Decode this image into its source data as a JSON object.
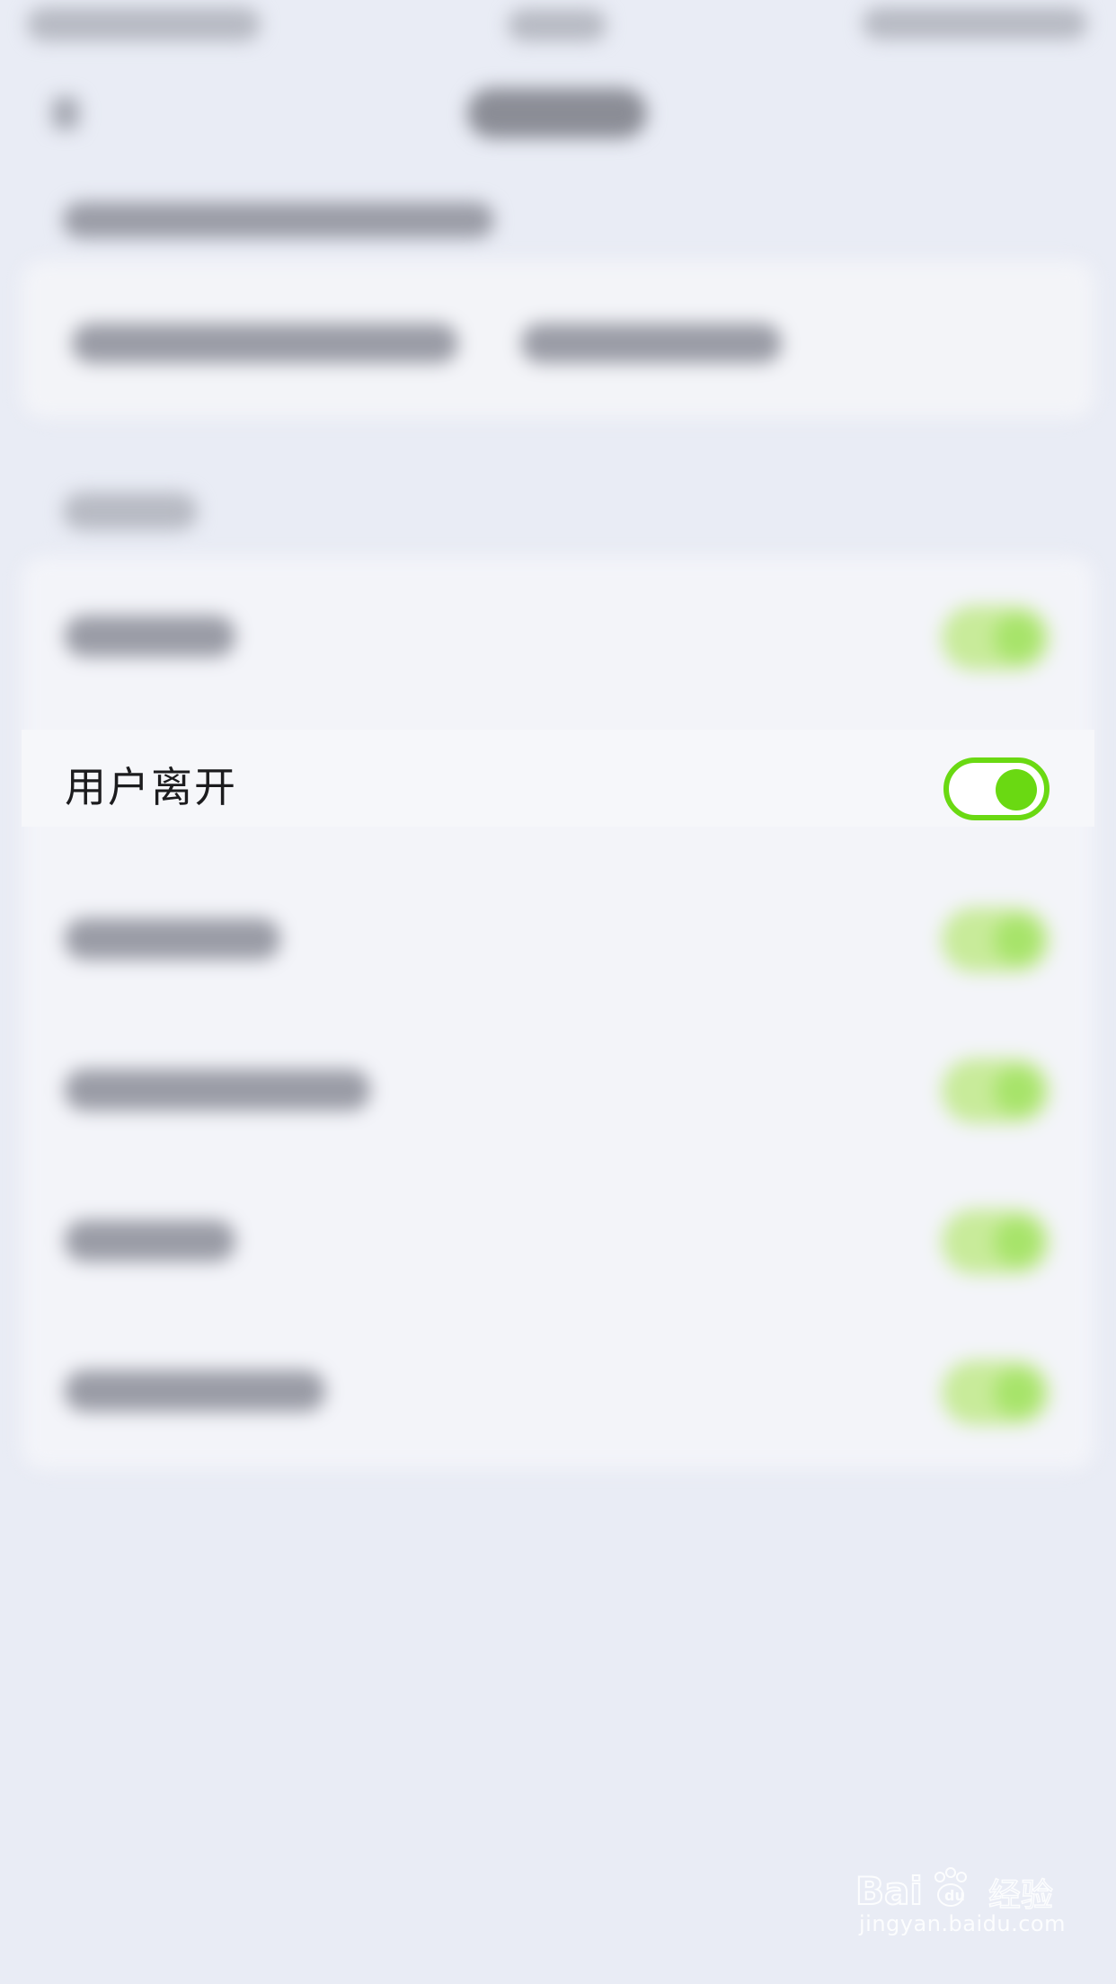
{
  "settings_row": {
    "label": "用户离开",
    "toggle_state": "on"
  },
  "colors": {
    "accent_green": "#6ad912",
    "background": "#e9ecf5",
    "card": "#f3f4f9"
  },
  "watermark": {
    "logo_text": "Baidu经验",
    "url": "jingyan.baidu.com"
  }
}
